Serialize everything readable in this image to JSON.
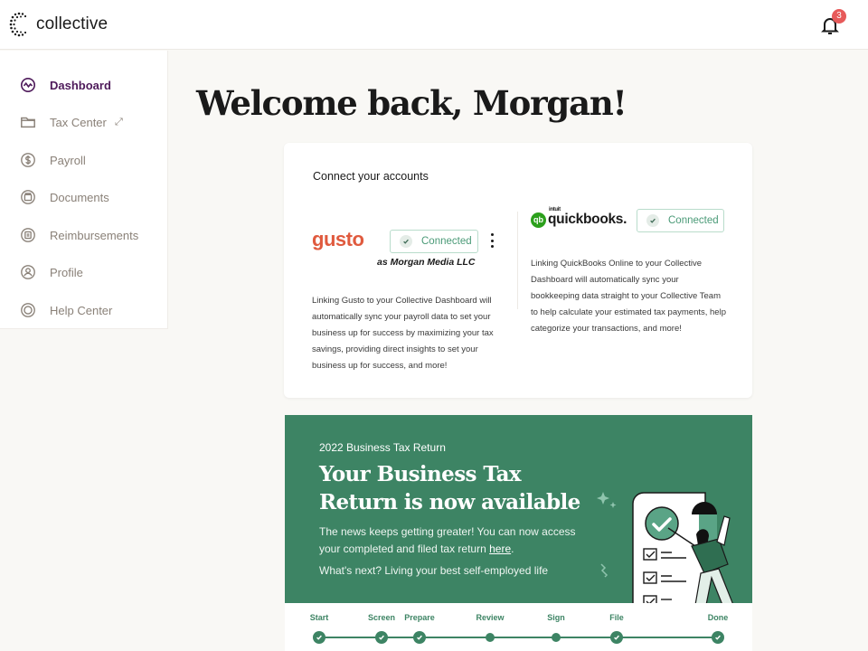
{
  "app": {
    "name": "collective",
    "notifications_count": "3"
  },
  "sidebar": {
    "items": [
      {
        "label": "Dashboard",
        "icon": "activity-icon",
        "active": true
      },
      {
        "label": "Tax Center",
        "icon": "folder-icon",
        "external": "⤢"
      },
      {
        "label": "Payroll",
        "icon": "dollar-icon"
      },
      {
        "label": "Documents",
        "icon": "documents-icon"
      },
      {
        "label": "Reimbursements",
        "icon": "receipt-icon"
      },
      {
        "label": "Profile",
        "icon": "user-icon"
      },
      {
        "label": "Help Center",
        "icon": "lifebuoy-icon"
      }
    ]
  },
  "main": {
    "welcome": "Welcome back, Morgan!",
    "accounts_card": {
      "title": "Connect your accounts",
      "gusto": {
        "logo": "gusto",
        "status": "Connected",
        "company": "as Morgan Media LLC",
        "description": "Linking Gusto to your Collective Dashboard will automatically sync your payroll data to set your business up for success by maximizing your tax savings, providing direct insights to set your business up for success, and more!"
      },
      "quickbooks": {
        "logo_mark": "qb",
        "logo_brand": "intuit",
        "logo_text": "quickbooks.",
        "status": "Connected",
        "description": "Linking QuickBooks Online to your Collective Dashboard will automatically sync your bookkeeping data straight to your Collective Team to help calculate your estimated tax payments, help categorize your transactions, and more!"
      }
    },
    "tax_banner": {
      "kicker": "2022 Business Tax Return",
      "title": "Your Business Tax Return is now available",
      "text_before_link": "The news keeps getting greater! You can now access your completed and filed tax return ",
      "link": "here",
      "text_after_link": ".",
      "next": "What's next? Living your best self-employed life"
    },
    "progress": {
      "steps": [
        {
          "label": "Start",
          "complete": true
        },
        {
          "label": "Screen",
          "complete": true
        },
        {
          "label": "Prepare",
          "complete": true
        },
        {
          "label": "Review",
          "complete": false
        },
        {
          "label": "Sign",
          "complete": false
        },
        {
          "label": "File",
          "complete": true
        },
        {
          "label": "Done",
          "complete": true
        }
      ]
    }
  },
  "colors": {
    "brand_purple": "#4e1a5a",
    "green": "#3d8464",
    "gusto": "#e05a3e",
    "quickbooks": "#2ca01c",
    "badge": "#e75a5a"
  }
}
